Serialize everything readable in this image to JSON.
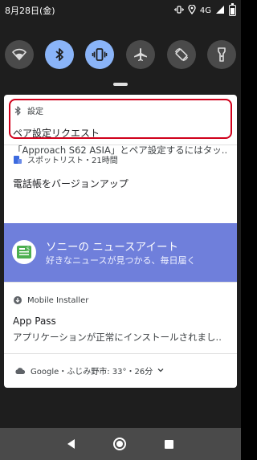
{
  "status_bar": {
    "time": "8月28日(金)",
    "network": "4G"
  },
  "quick_settings": {
    "tiles": [
      {
        "name": "wifi",
        "state": "off"
      },
      {
        "name": "bluetooth",
        "state": "on"
      },
      {
        "name": "vibrate",
        "state": "on"
      },
      {
        "name": "airplane",
        "state": "off"
      },
      {
        "name": "auto-rotate",
        "state": "off"
      },
      {
        "name": "flashlight",
        "state": "off"
      }
    ],
    "accent": "#8ab4f8"
  },
  "notifications": {
    "bluetooth": {
      "app": "設定",
      "title": "ペア設定リクエスト",
      "body": "「Approach S62 ASIA」とペア設定するにはタッ.."
    },
    "spot": {
      "app": "スポットリスト・21時間",
      "title": "電話帳をバージョンアップ"
    },
    "sony": {
      "title": "ソニーの ニュースアイート",
      "subtitle": "好きなニュースが見つかる、毎日届く",
      "color": "#6f7fdb"
    },
    "installer": {
      "app": "Mobile Installer",
      "title": "App Pass",
      "body": "アプリケーションが正常にインストールされまし.."
    },
    "weather": {
      "text": "Google・ふじみ野市: 33°・26分"
    }
  },
  "highlight_color": "#d0001b"
}
